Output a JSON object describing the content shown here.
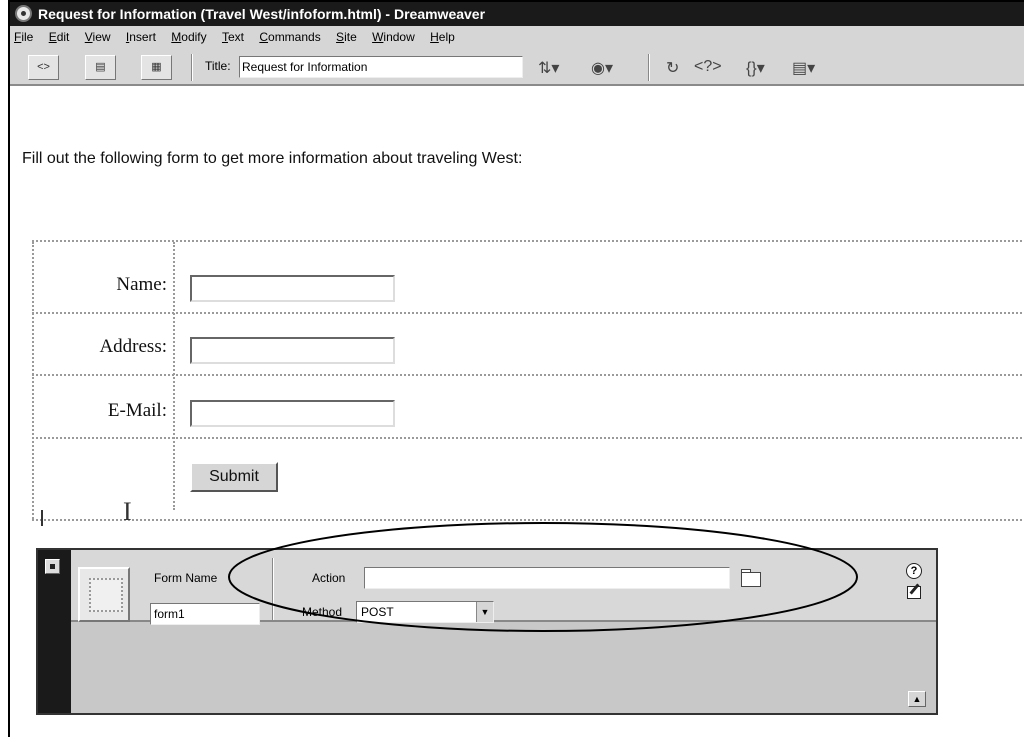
{
  "window": {
    "title": "Request for Information (Travel West/infoform.html) - Dreamweaver"
  },
  "menu": [
    "File",
    "Edit",
    "View",
    "Insert",
    "Modify",
    "Text",
    "Commands",
    "Site",
    "Window",
    "Help"
  ],
  "toolbar": {
    "view_buttons": [
      "code-view",
      "split-view",
      "design-view"
    ],
    "title_label": "Title:",
    "title_value": "Request for Information",
    "icons": [
      "file-management-icon",
      "preview-globe-icon",
      "refresh-icon",
      "code-navigation-icon",
      "braces-icon",
      "view-options-icon"
    ]
  },
  "document": {
    "intro": "Fill out the following form to get more information about traveling West:",
    "fields": [
      {
        "label": "Name:",
        "value": ""
      },
      {
        "label": "Address:",
        "value": ""
      },
      {
        "label": "E-Mail:",
        "value": ""
      }
    ],
    "submit_label": "Submit"
  },
  "inspector": {
    "form_name_label": "Form Name",
    "form_name_value": "form1",
    "action_label": "Action",
    "action_value": "",
    "method_label": "Method",
    "method_value": "POST"
  }
}
